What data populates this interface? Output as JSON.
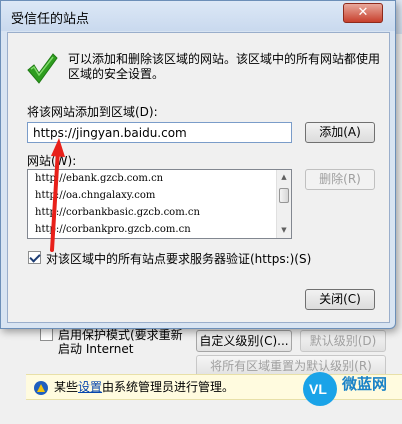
{
  "dialog": {
    "title": "受信任的站点",
    "close_symbol": "✕",
    "description": "可以添加和删除该区域的网站。该区域中的所有网站都使用区域的安全设置。",
    "add_label": "将该网站添加到区域(D):",
    "url_value": "https://jingyan.baidu.com",
    "add_button": "添加(A)",
    "sites_label": "网站(W):",
    "sites": [
      "http://ebank.gzcb.com.cn",
      "http://oa.chngalaxy.com",
      "http://corbankbasic.gzcb.com.cn",
      "http://corbankpro.gzcb.com.cn"
    ],
    "remove_button": "删除(R)",
    "https_checkbox_label": "对该区域中的所有站点要求服务器验证(https:)(S)",
    "https_checked": true,
    "close_button": "关闭(C)"
  },
  "background": {
    "protected_mode_line1": "启用保护模式(要求重新",
    "protected_mode_line2": "启动 Internet",
    "custom_level_button": "自定义级别(C)...",
    "default_level_button": "默认级别(D)",
    "reset_all_button": "将所有区域重置为默认级别(R)",
    "info_prefix": "某些",
    "info_link": "设置",
    "info_suffix": "由系统管理员进行管理。"
  },
  "watermark": {
    "badge": "VL",
    "name": "微蓝网"
  },
  "colors": {
    "arrow": "#e8201a",
    "check_green": "#2e9d1f",
    "title_bg": "#d8e4f2"
  }
}
